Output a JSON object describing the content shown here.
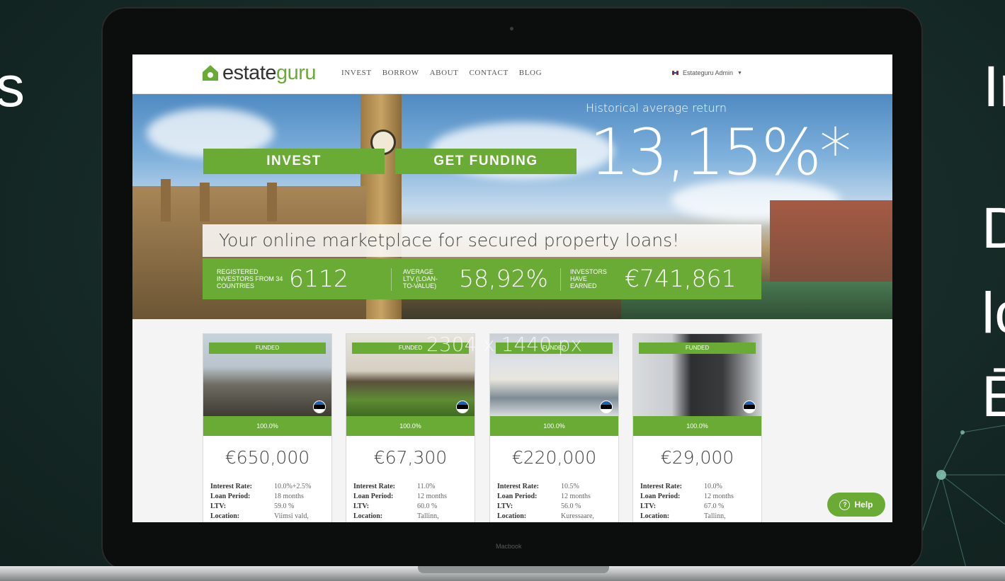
{
  "slide": {
    "left_fragment": "s",
    "right_fragments": [
      "Ir",
      "D",
      "lo",
      "Ē"
    ]
  },
  "device": {
    "label": "Macbook"
  },
  "site": {
    "logo_prefix": "estate",
    "logo_suffix": "guru",
    "nav": [
      "INVEST",
      "BORROW",
      "ABOUT",
      "CONTACT",
      "BLOG"
    ],
    "user_menu": "Estateguru Admin"
  },
  "hero": {
    "caption": "Historical average return",
    "big_value": "13,15%*",
    "cta_invest": "INVEST",
    "cta_funding": "GET FUNDING",
    "tagline": "Your online marketplace for secured property loans!",
    "stats": [
      {
        "label": "REGISTERED INVESTORS FROM 34 COUNTRIES",
        "value": "6112"
      },
      {
        "label": "AVERAGE LTV (LOAN-TO-VALUE)",
        "value": "58,92%"
      },
      {
        "label": "INVESTORS HAVE EARNED",
        "value": "€741,861"
      }
    ]
  },
  "overlay_label": "2304 x 1440 px",
  "cards": [
    {
      "badge": "FUNDED",
      "progress": "100.0%",
      "amount": "€650,000",
      "interest_key": "Interest Rate:",
      "interest": "10.0%+2.5%",
      "period_key": "Loan Period:",
      "period": "18 months",
      "ltv_key": "LTV:",
      "ltv": "59.0 %",
      "location_key": "Location:",
      "location": "Viimsi vald,"
    },
    {
      "badge": "FUNDED",
      "progress": "100.0%",
      "amount": "€67,300",
      "interest_key": "Interest Rate:",
      "interest": "11.0%",
      "period_key": "Loan Period:",
      "period": "12 months",
      "ltv_key": "LTV:",
      "ltv": "60.0 %",
      "location_key": "Location:",
      "location": "Tallinn,"
    },
    {
      "badge": "FUNDED",
      "progress": "100.0%",
      "amount": "€220,000",
      "interest_key": "Interest Rate:",
      "interest": "10.5%",
      "period_key": "Loan Period:",
      "period": "12 months",
      "ltv_key": "LTV:",
      "ltv": "56.0 %",
      "location_key": "Location:",
      "location": "Kuressaare,"
    },
    {
      "badge": "FUNDED",
      "progress": "100.0%",
      "amount": "€29,000",
      "interest_key": "Interest Rate:",
      "interest": "10.0%",
      "period_key": "Loan Period:",
      "period": "12 months",
      "ltv_key": "LTV:",
      "ltv": "67.0 %",
      "location_key": "Location:",
      "location": "Tallinn,"
    }
  ],
  "help": {
    "label": "Help"
  },
  "colors": {
    "brand_green": "#6aab35",
    "slide_bg": "#18302c"
  }
}
